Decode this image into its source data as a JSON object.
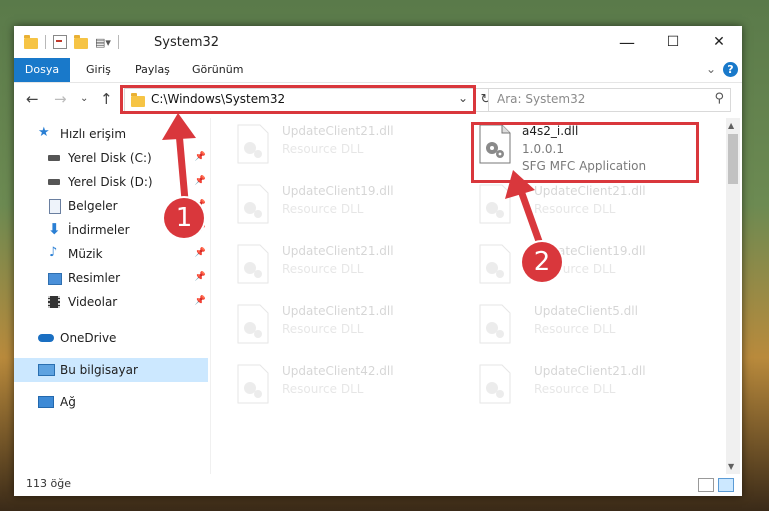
{
  "window": {
    "title": "System32",
    "controls": {
      "minimize": "—",
      "maximize": "☐",
      "close": "✕"
    }
  },
  "ribbon": {
    "tabs": [
      "Dosya",
      "Giriş",
      "Paylaş",
      "Görünüm"
    ],
    "help": "?"
  },
  "address": {
    "path": "C:\\Windows\\System32",
    "search_placeholder": "Ara: System32"
  },
  "sidebar": {
    "items": [
      {
        "label": "Hızlı erişim",
        "icon": "star-icon",
        "pinned": false
      },
      {
        "label": "Yerel Disk (C:)",
        "icon": "drive-icon",
        "pinned": true
      },
      {
        "label": "Yerel Disk (D:)",
        "icon": "drive-icon",
        "pinned": true
      },
      {
        "label": "Belgeler",
        "icon": "documents-icon",
        "pinned": true
      },
      {
        "label": "İndirmeler",
        "icon": "download-icon",
        "pinned": true
      },
      {
        "label": "Müzik",
        "icon": "music-icon",
        "pinned": true
      },
      {
        "label": "Resimler",
        "icon": "pictures-icon",
        "pinned": true
      },
      {
        "label": "Videolar",
        "icon": "video-icon",
        "pinned": true
      },
      {
        "label": "OneDrive",
        "icon": "cloud-icon",
        "pinned": false
      },
      {
        "label": "Bu bilgisayar",
        "icon": "computer-icon",
        "pinned": false,
        "selected": true
      },
      {
        "label": "Ağ",
        "icon": "network-icon",
        "pinned": false
      }
    ]
  },
  "files": {
    "left_column": [
      {
        "name": "UpdateClient21.dll",
        "desc": "Resource DLL"
      },
      {
        "name": "UpdateClient19.dll",
        "desc": "Resource DLL"
      },
      {
        "name": "UpdateClient21.dll",
        "desc": "Resource DLL"
      },
      {
        "name": "UpdateClient21.dll",
        "desc": "Resource DLL"
      },
      {
        "name": "UpdateClient42.dll",
        "desc": "Resource DLL"
      }
    ],
    "highlighted": {
      "name": "a4s2_i.dll",
      "version": "1.0.0.1",
      "desc": "SFG MFC Application"
    },
    "right_column": [
      {
        "name": "UpdateClient21.dll",
        "desc": "Resource DLL"
      },
      {
        "name": "UpdateClient19.dll",
        "desc": "Resource DLL"
      },
      {
        "name": "UpdateClient5.dll",
        "desc": "Resource DLL"
      },
      {
        "name": "UpdateClient21.dll",
        "desc": "Resource DLL"
      }
    ]
  },
  "status": {
    "count": "113 öğe"
  },
  "annotations": {
    "step1": "1",
    "step2": "2",
    "color": "#d9373c"
  }
}
